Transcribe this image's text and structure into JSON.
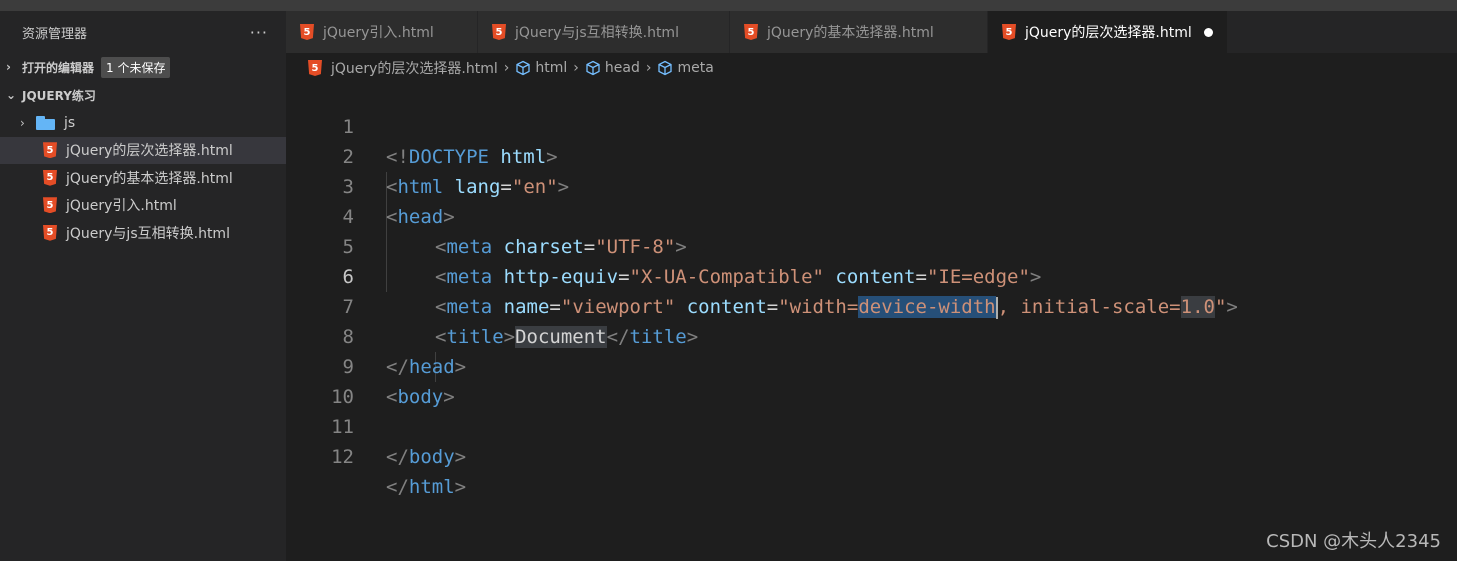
{
  "sidebar": {
    "title": "资源管理器",
    "more": "···",
    "open_editors": {
      "label": "打开的编辑器",
      "badge": "1 个未保存"
    },
    "project": {
      "label": "JQUERY练习"
    },
    "items": [
      {
        "label": "js",
        "type": "folder"
      },
      {
        "label": "jQuery的层次选择器.html",
        "type": "html"
      },
      {
        "label": "jQuery的基本选择器.html",
        "type": "html"
      },
      {
        "label": "jQuery引入.html",
        "type": "html"
      },
      {
        "label": "jQuery与js互相转换.html",
        "type": "html"
      }
    ]
  },
  "tabs": [
    {
      "label": "jQuery引入.html"
    },
    {
      "label": "jQuery与js互相转换.html"
    },
    {
      "label": "jQuery的基本选择器.html"
    },
    {
      "label": "jQuery的层次选择器.html"
    }
  ],
  "breadcrumb": [
    "jQuery的层次选择器.html",
    "html",
    "head",
    "meta"
  ],
  "code": {
    "line_numbers": [
      "1",
      "2",
      "3",
      "4",
      "5",
      "6",
      "7",
      "8",
      "9",
      "10",
      "11",
      "12"
    ],
    "l1": {
      "a": "<!",
      "b": "DOCTYPE",
      "c": " html",
      "d": ">"
    },
    "l2": {
      "a": "<",
      "b": "html",
      "c": " lang",
      "d": "=",
      "e": "\"en\"",
      "f": ">"
    },
    "l3": {
      "a": "<",
      "b": "head",
      "c": ">"
    },
    "l4": {
      "a": "<",
      "b": "meta",
      "c": " charset",
      "d": "=",
      "e": "\"UTF-8\"",
      "f": ">"
    },
    "l5": {
      "a": "<",
      "b": "meta",
      "c": " http-equiv",
      "d": "=",
      "e": "\"X-UA-Compatible\"",
      "f": " content",
      "g": "=",
      "h": "\"IE=edge\"",
      "i": ">"
    },
    "l6": {
      "a": "<",
      "b": "meta",
      "c": " name",
      "d": "=",
      "e": "\"viewport\"",
      "f": " content",
      "g": "=",
      "h1": "\"width=",
      "h2": "device-width",
      "h3": ", initial-scale=",
      "h4": "1.0",
      "h5": "\"",
      "i": ">"
    },
    "l7": {
      "a": "<",
      "b": "title",
      "c": ">",
      "d": "Document",
      "e": "</",
      "f": "title",
      "g": ">"
    },
    "l8": {
      "a": "</",
      "b": "head",
      "c": ">"
    },
    "l9": {
      "a": "<",
      "b": "body",
      "c": ">"
    },
    "l11": {
      "a": "</",
      "b": "body",
      "c": ">"
    },
    "l12": {
      "a": "</",
      "b": "html",
      "c": ">"
    }
  },
  "watermark": "CSDN @木头人2345",
  "colors": {
    "tag": "#569cd6",
    "attr": "#9cdcfe",
    "string": "#ce9178",
    "punct": "#808080",
    "html_icon": "#e44d26",
    "folder": "#64b5f6"
  }
}
